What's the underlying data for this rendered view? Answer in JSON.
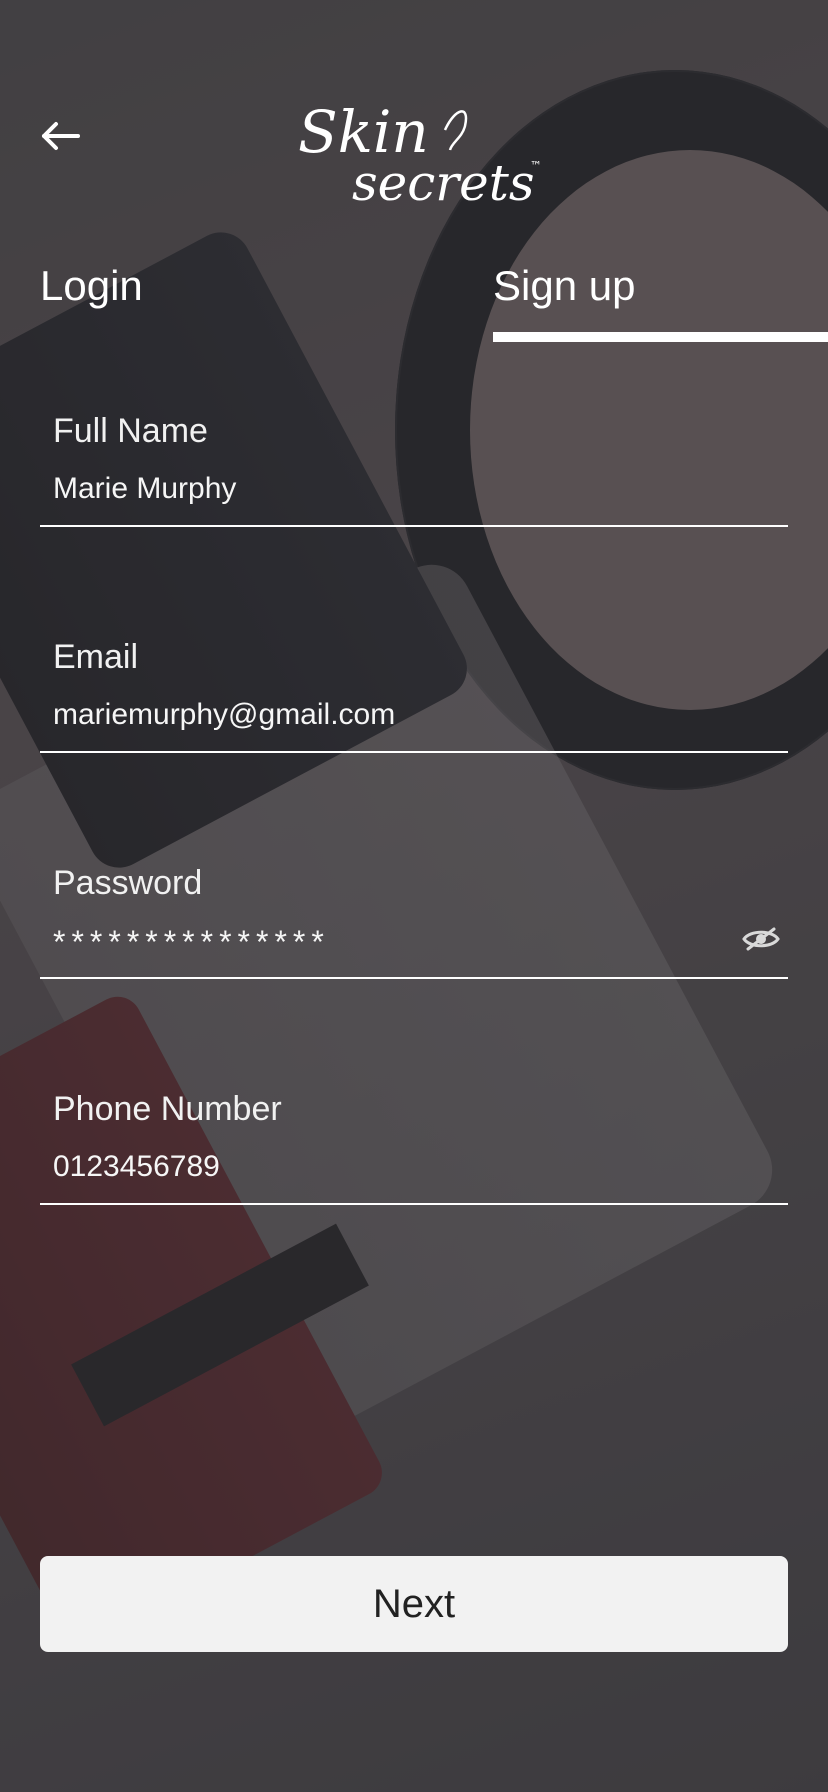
{
  "brand": {
    "logo_line1": "Skin",
    "logo_line2": "secrets",
    "logo_tm": "™"
  },
  "header": {
    "back_icon": "arrow-left-icon"
  },
  "tabs": [
    {
      "label": "Login",
      "active": false
    },
    {
      "label": "Sign up",
      "active": true
    }
  ],
  "form": {
    "full_name": {
      "label": "Full Name",
      "value": "Marie Murphy"
    },
    "email": {
      "label": "Email",
      "value": "mariemurphy@gmail.com"
    },
    "password": {
      "label": "Password",
      "value": "***************",
      "toggle_icon": "eye-slash-icon"
    },
    "phone": {
      "label": "Phone Number",
      "value": "0123456789"
    }
  },
  "actions": {
    "next_label": "Next"
  },
  "colors": {
    "text": "#ffffff",
    "button_bg": "#f2f2f2",
    "button_text": "#222222",
    "overlay": "#3c3a3e"
  }
}
